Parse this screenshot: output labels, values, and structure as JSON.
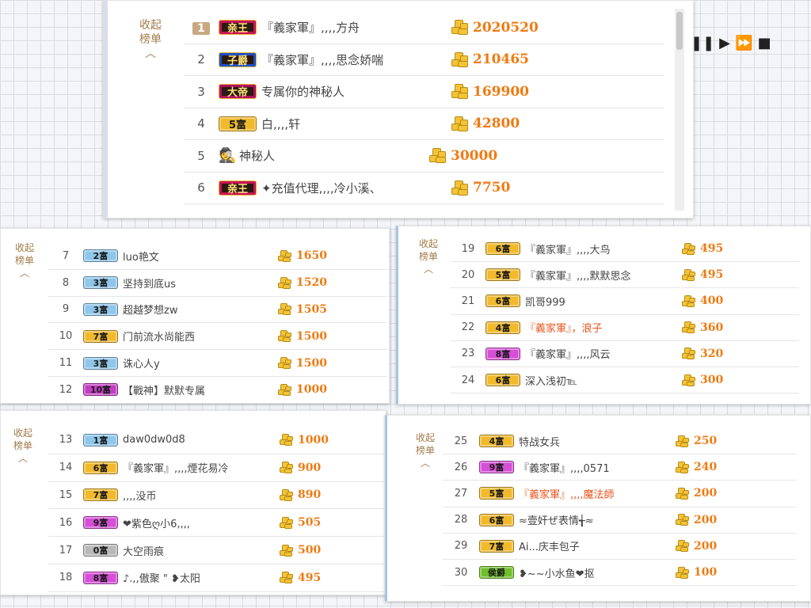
{
  "collapse_label_top": "收起",
  "collapse_label_bottom": "榜单",
  "panels": [
    {
      "rows": [
        {
          "rank": "1",
          "badge": "亲王",
          "name": "『義家軍』,,,,方舟",
          "amount": "2020520"
        },
        {
          "rank": "2",
          "badge": "子爵",
          "name": "『義家軍』,,,,思念娇喘",
          "amount": "210465"
        },
        {
          "rank": "3",
          "badge": "大帝",
          "name": "专属你的神秘人",
          "amount": "169900"
        },
        {
          "rank": "4",
          "badge": "5富",
          "name": "白,,,,轩",
          "amount": "42800"
        },
        {
          "rank": "5",
          "badge": "",
          "name": "神秘人",
          "amount": "30000"
        },
        {
          "rank": "6",
          "badge": "亲王",
          "name": "✦充值代理,,,,冷小溪、",
          "amount": "7750"
        }
      ]
    },
    {
      "rows": [
        {
          "rank": "7",
          "badge": "2富",
          "name": "luo艳文",
          "amount": "1650"
        },
        {
          "rank": "8",
          "badge": "3富",
          "name": "坚持到底us",
          "amount": "1520"
        },
        {
          "rank": "9",
          "badge": "3富",
          "name": "超越梦想zw",
          "amount": "1505"
        },
        {
          "rank": "10",
          "badge": "7富",
          "name": "门前流水尚能西",
          "amount": "1500"
        },
        {
          "rank": "11",
          "badge": "3富",
          "name": "诛心人y",
          "amount": "1500"
        },
        {
          "rank": "12",
          "badge": "10富",
          "name": "【戰神】默默专属",
          "amount": "1000"
        }
      ]
    },
    {
      "rows": [
        {
          "rank": "19",
          "badge": "6富",
          "name": "『義家軍』,,,,大鸟",
          "amount": "495"
        },
        {
          "rank": "20",
          "badge": "5富",
          "name": "『義家軍』,,,,默默思念",
          "amount": "495"
        },
        {
          "rank": "21",
          "badge": "6富",
          "name": "凯哥999",
          "amount": "400"
        },
        {
          "rank": "22",
          "badge": "4富",
          "name": "『義家軍』，浪子",
          "amount": "360"
        },
        {
          "rank": "23",
          "badge": "8富",
          "name": "『義家軍』,,,,风云",
          "amount": "320"
        },
        {
          "rank": "24",
          "badge": "6富",
          "name": "深入浅初℡",
          "amount": "300"
        }
      ]
    },
    {
      "rows": [
        {
          "rank": "13",
          "badge": "1富",
          "name": "daw0dw0d8",
          "amount": "1000"
        },
        {
          "rank": "14",
          "badge": "6富",
          "name": "『義家軍』,,,,煙花易冷",
          "amount": "900"
        },
        {
          "rank": "15",
          "badge": "7富",
          "name": ",,,,没币",
          "amount": "890"
        },
        {
          "rank": "16",
          "badge": "9富",
          "name": "❤紫色ღ小6,,,,",
          "amount": "505"
        },
        {
          "rank": "17",
          "badge": "0富",
          "name": "大空雨痕",
          "amount": "500"
        },
        {
          "rank": "18",
          "badge": "8富",
          "name": "♪.,,傲聚 \" ❥太阳",
          "amount": "495"
        }
      ]
    },
    {
      "rows": [
        {
          "rank": "25",
          "badge": "4富",
          "name": "特战女兵",
          "amount": "250"
        },
        {
          "rank": "26",
          "badge": "9富",
          "name": "『義家軍』,,,,0571",
          "amount": "240"
        },
        {
          "rank": "27",
          "badge": "5富",
          "name": "『義家軍』,,,,魔法師",
          "amount": "200"
        },
        {
          "rank": "28",
          "badge": "6富",
          "name": "≈壹奸ぜ表情╅≈",
          "amount": "200"
        },
        {
          "rank": "29",
          "badge": "7富",
          "name": "Ai...庆丰包子",
          "amount": "200"
        },
        {
          "rank": "30",
          "badge": "侯爵",
          "name": "❥~~小水鱼❤抠",
          "amount": "100"
        }
      ]
    }
  ],
  "colors": {
    "amount": "#f07a12",
    "collapse": "#a27b4a",
    "highlight_name": "#e8541c",
    "coin": "#f3c338"
  },
  "badge_colors": {
    "亲王": "#c8145a",
    "子爵": "#1f4fc8",
    "大帝": "#b01060",
    "侯爵": "#6fbf2a",
    "0富": "#b8b8b8",
    "1富": "#8fc6ea",
    "2富": "#8fc6ea",
    "3富": "#8fc6ea",
    "4富": "#f1b92c",
    "5富": "#f1b92c",
    "6富": "#f1b92c",
    "7富": "#f1b92c",
    "8富": "#d64fd6",
    "9富": "#d64fd6",
    "10富": "#c43cc4"
  },
  "media_controls": [
    "pause-icon",
    "play-icon",
    "fast-forward-icon",
    "stop-icon"
  ]
}
